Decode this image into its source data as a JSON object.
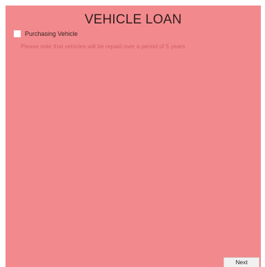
{
  "header": {
    "title": "VEHICLE LOAN"
  },
  "form": {
    "checkbox_label": "Purchasing Vehicle",
    "checkbox_checked": false,
    "note": "Please note that vehicles will be repaid over a period of 5 years"
  },
  "footer": {
    "next_label": "Next"
  },
  "colors": {
    "panel_background": "#f28a8d",
    "note_text": "#d05f64"
  }
}
